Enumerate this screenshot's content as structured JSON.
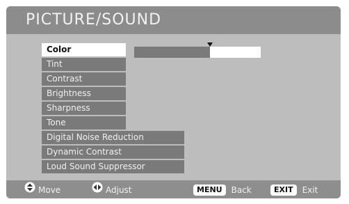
{
  "menu": {
    "title": "PICTURE/SOUND",
    "items": [
      {
        "label": "Color",
        "selected": true
      },
      {
        "label": "Tint",
        "selected": false
      },
      {
        "label": "Contrast",
        "selected": false
      },
      {
        "label": "Brightness",
        "selected": false
      },
      {
        "label": "Sharpness",
        "selected": false
      },
      {
        "label": "Tone",
        "selected": false
      },
      {
        "label": "Digital Noise Reduction",
        "selected": false
      },
      {
        "label": "Dynamic Contrast",
        "selected": false
      },
      {
        "label": "Loud Sound Suppressor",
        "selected": false
      }
    ]
  },
  "color_slider": {
    "level_fraction": 0.6
  },
  "footer": {
    "move_icon": "up-down-arrows-icon",
    "move_label": "Move",
    "adjust_icon": "left-right-arrows-icon",
    "adjust_label": "Adjust",
    "menu_key": "MENU",
    "menu_label": "Back",
    "exit_key": "EXIT",
    "exit_label": "Exit"
  },
  "colors": {
    "frame": "#aeaeae",
    "title_bar": "#8c8c8c",
    "panel": "#bdbdbd",
    "item": "#7a7a7a",
    "selected_item": "#ffffff"
  }
}
